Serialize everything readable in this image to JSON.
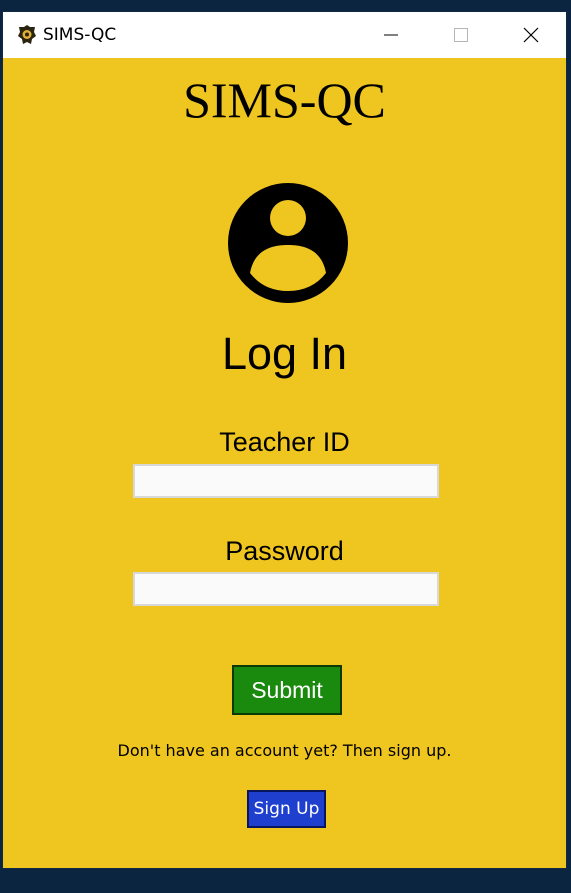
{
  "window": {
    "title": "SIMS-QC",
    "icon": "police-badge-icon",
    "controls": [
      "minimize-icon",
      "maximize-icon",
      "close-icon"
    ]
  },
  "app": {
    "title": "SIMS-QC",
    "avatar_icon": "user-account-icon",
    "heading": "Log In"
  },
  "form": {
    "teacher_id_label": "Teacher ID",
    "teacher_id_value": "",
    "password_label": "Password",
    "password_value": "",
    "submit_label": "Submit"
  },
  "signup": {
    "prompt": "Don't have an account yet? Then sign up.",
    "button_label": "Sign Up"
  },
  "colors": {
    "background": "#efc520",
    "submit": "#1a8a0f",
    "signup": "#1f3fcf",
    "desktop": "#0b2540"
  }
}
